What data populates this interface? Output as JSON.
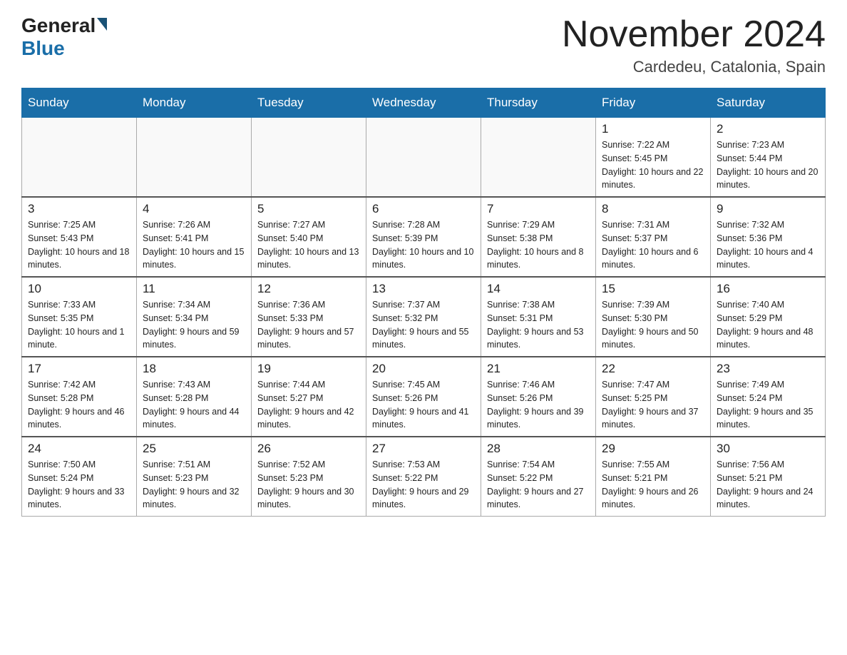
{
  "header": {
    "logo_general": "General",
    "logo_blue": "Blue",
    "month_year": "November 2024",
    "location": "Cardedeu, Catalonia, Spain"
  },
  "days_of_week": [
    "Sunday",
    "Monday",
    "Tuesday",
    "Wednesday",
    "Thursday",
    "Friday",
    "Saturday"
  ],
  "weeks": [
    [
      {
        "day": "",
        "info": ""
      },
      {
        "day": "",
        "info": ""
      },
      {
        "day": "",
        "info": ""
      },
      {
        "day": "",
        "info": ""
      },
      {
        "day": "",
        "info": ""
      },
      {
        "day": "1",
        "info": "Sunrise: 7:22 AM\nSunset: 5:45 PM\nDaylight: 10 hours and 22 minutes."
      },
      {
        "day": "2",
        "info": "Sunrise: 7:23 AM\nSunset: 5:44 PM\nDaylight: 10 hours and 20 minutes."
      }
    ],
    [
      {
        "day": "3",
        "info": "Sunrise: 7:25 AM\nSunset: 5:43 PM\nDaylight: 10 hours and 18 minutes."
      },
      {
        "day": "4",
        "info": "Sunrise: 7:26 AM\nSunset: 5:41 PM\nDaylight: 10 hours and 15 minutes."
      },
      {
        "day": "5",
        "info": "Sunrise: 7:27 AM\nSunset: 5:40 PM\nDaylight: 10 hours and 13 minutes."
      },
      {
        "day": "6",
        "info": "Sunrise: 7:28 AM\nSunset: 5:39 PM\nDaylight: 10 hours and 10 minutes."
      },
      {
        "day": "7",
        "info": "Sunrise: 7:29 AM\nSunset: 5:38 PM\nDaylight: 10 hours and 8 minutes."
      },
      {
        "day": "8",
        "info": "Sunrise: 7:31 AM\nSunset: 5:37 PM\nDaylight: 10 hours and 6 minutes."
      },
      {
        "day": "9",
        "info": "Sunrise: 7:32 AM\nSunset: 5:36 PM\nDaylight: 10 hours and 4 minutes."
      }
    ],
    [
      {
        "day": "10",
        "info": "Sunrise: 7:33 AM\nSunset: 5:35 PM\nDaylight: 10 hours and 1 minute."
      },
      {
        "day": "11",
        "info": "Sunrise: 7:34 AM\nSunset: 5:34 PM\nDaylight: 9 hours and 59 minutes."
      },
      {
        "day": "12",
        "info": "Sunrise: 7:36 AM\nSunset: 5:33 PM\nDaylight: 9 hours and 57 minutes."
      },
      {
        "day": "13",
        "info": "Sunrise: 7:37 AM\nSunset: 5:32 PM\nDaylight: 9 hours and 55 minutes."
      },
      {
        "day": "14",
        "info": "Sunrise: 7:38 AM\nSunset: 5:31 PM\nDaylight: 9 hours and 53 minutes."
      },
      {
        "day": "15",
        "info": "Sunrise: 7:39 AM\nSunset: 5:30 PM\nDaylight: 9 hours and 50 minutes."
      },
      {
        "day": "16",
        "info": "Sunrise: 7:40 AM\nSunset: 5:29 PM\nDaylight: 9 hours and 48 minutes."
      }
    ],
    [
      {
        "day": "17",
        "info": "Sunrise: 7:42 AM\nSunset: 5:28 PM\nDaylight: 9 hours and 46 minutes."
      },
      {
        "day": "18",
        "info": "Sunrise: 7:43 AM\nSunset: 5:28 PM\nDaylight: 9 hours and 44 minutes."
      },
      {
        "day": "19",
        "info": "Sunrise: 7:44 AM\nSunset: 5:27 PM\nDaylight: 9 hours and 42 minutes."
      },
      {
        "day": "20",
        "info": "Sunrise: 7:45 AM\nSunset: 5:26 PM\nDaylight: 9 hours and 41 minutes."
      },
      {
        "day": "21",
        "info": "Sunrise: 7:46 AM\nSunset: 5:26 PM\nDaylight: 9 hours and 39 minutes."
      },
      {
        "day": "22",
        "info": "Sunrise: 7:47 AM\nSunset: 5:25 PM\nDaylight: 9 hours and 37 minutes."
      },
      {
        "day": "23",
        "info": "Sunrise: 7:49 AM\nSunset: 5:24 PM\nDaylight: 9 hours and 35 minutes."
      }
    ],
    [
      {
        "day": "24",
        "info": "Sunrise: 7:50 AM\nSunset: 5:24 PM\nDaylight: 9 hours and 33 minutes."
      },
      {
        "day": "25",
        "info": "Sunrise: 7:51 AM\nSunset: 5:23 PM\nDaylight: 9 hours and 32 minutes."
      },
      {
        "day": "26",
        "info": "Sunrise: 7:52 AM\nSunset: 5:23 PM\nDaylight: 9 hours and 30 minutes."
      },
      {
        "day": "27",
        "info": "Sunrise: 7:53 AM\nSunset: 5:22 PM\nDaylight: 9 hours and 29 minutes."
      },
      {
        "day": "28",
        "info": "Sunrise: 7:54 AM\nSunset: 5:22 PM\nDaylight: 9 hours and 27 minutes."
      },
      {
        "day": "29",
        "info": "Sunrise: 7:55 AM\nSunset: 5:21 PM\nDaylight: 9 hours and 26 minutes."
      },
      {
        "day": "30",
        "info": "Sunrise: 7:56 AM\nSunset: 5:21 PM\nDaylight: 9 hours and 24 minutes."
      }
    ]
  ]
}
